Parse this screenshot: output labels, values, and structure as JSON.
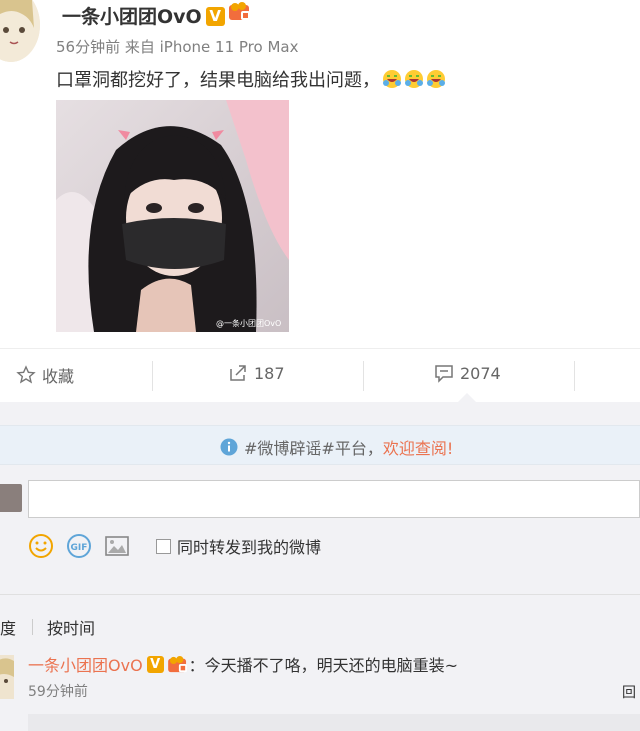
{
  "post": {
    "author": "一条小团团OvO",
    "verified_badge": "V",
    "time": "56分钟前",
    "source": "来自 iPhone 11 Pro Max",
    "text": "口罩洞都挖好了，结果电脑给我出问题，",
    "emoji_count": 3,
    "photo_watermark": "@一条小团团OvO"
  },
  "actions": {
    "favorite_label": "收藏",
    "repost_count": "187",
    "comment_count": "2074"
  },
  "notice": {
    "text": "#微博辟谣#平台，",
    "link": "欢迎查阅!"
  },
  "composer": {
    "placeholder": "",
    "repost_option": "同时转发到我的微博"
  },
  "sort": {
    "hot": "热度",
    "by_time": "按时间"
  },
  "comment": {
    "author": "一条小团团OvO",
    "verified_badge": "V",
    "text": "：今天播不了咯，明天还的电脑重装~",
    "time": "59分钟前",
    "reply": "回"
  },
  "colors": {
    "accent": "#eb7350",
    "vip": "#f2a500",
    "info": "#5fa5d8"
  }
}
